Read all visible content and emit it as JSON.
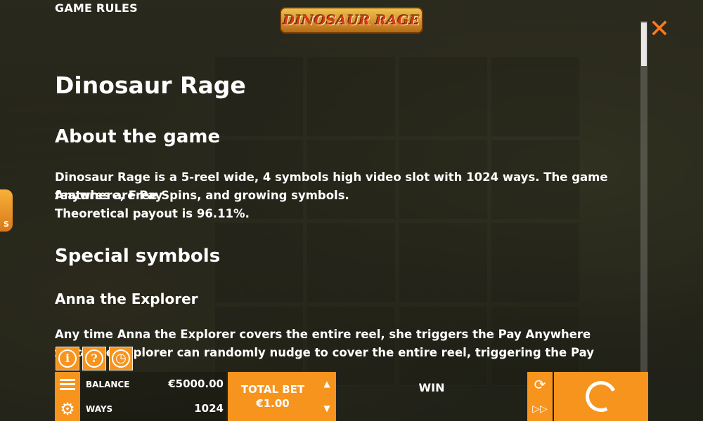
{
  "header": {
    "title": "GAME RULES",
    "logo_text": "DINOSAUR RAGE",
    "close_glyph": "✕"
  },
  "content": {
    "title": "Dinosaur Rage",
    "about_heading": "About the game",
    "about_p1_line1": "Dinosaur Rage is a 5-reel wide, 4 symbols high video slot with 1024 ways. The game features are Pay",
    "about_p1_line2": "Anywhere, Free Spins, and growing symbols.",
    "about_p2": "Theoretical payout is 96.11%.",
    "special_heading": "Special symbols",
    "anna_heading": "Anna the Explorer",
    "anna_p1": "Any time Anna the Explorer covers the entire reel, she triggers the Pay Anywhere feature.",
    "anna_p2": "Anna the Explorer can randomly nudge to cover the entire reel, triggering the Pay Anywhere feature."
  },
  "side_tab": {
    "label": "S"
  },
  "quick_buttons": [
    {
      "name": "info-icon",
      "glyph": "i"
    },
    {
      "name": "help-icon",
      "glyph": "?"
    },
    {
      "name": "history-icon",
      "glyph": "◷"
    }
  ],
  "bottom_bar": {
    "balance_label": "BALANCE",
    "balance_value": "€5000.00",
    "ways_label": "WAYS",
    "ways_value": "1024",
    "total_bet_label": "TOTAL BET",
    "total_bet_value": "€1.00",
    "win_label": "WIN",
    "bet_up_glyph": "▲",
    "bet_down_glyph": "▼",
    "autoplay_glyph": "⟳",
    "fast_glyph": "▷▷"
  },
  "colors": {
    "accent": "#f7941d",
    "close": "#ff7b1a",
    "text": "#ffffff"
  }
}
